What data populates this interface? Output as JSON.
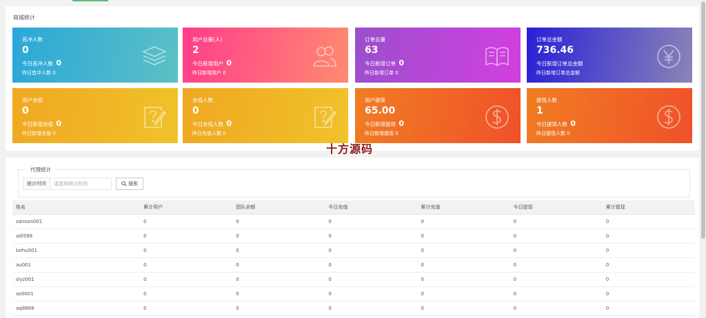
{
  "stats_panel": {
    "title": "商城统计",
    "cards": [
      {
        "title": "首冲人数",
        "value": "0",
        "line1_label": "今日首冲人数",
        "line1_value": "0",
        "line2": "昨日首冲人数 0",
        "icon": "layers-icon",
        "gradient": [
          "#2aa7d9",
          "#5cc0c5"
        ]
      },
      {
        "title": "用户总量(人)",
        "value": "2",
        "line1_label": "今日新增用户",
        "line1_value": "0",
        "line2": "昨日新增用户 0",
        "icon": "users-icon",
        "gradient": [
          "#ff3d8b",
          "#ff8a70"
        ]
      },
      {
        "title": "订单总量",
        "value": "63",
        "line1_label": "今日新增订单",
        "line1_value": "0",
        "line2": "昨日新增订单 0",
        "icon": "book-icon",
        "gradient": [
          "#9b4fcc",
          "#d23fe0"
        ]
      },
      {
        "title": "订单总金额",
        "value": "736.46",
        "line1_label": "今日新增订单总金额",
        "line1_value": "",
        "line2": "昨日新增订单总金额",
        "icon": "yen-icon",
        "gradient": [
          "#2a1fd6",
          "#8a85b8"
        ]
      },
      {
        "title": "用户充值",
        "value": "0",
        "line1_label": "今日新增充值",
        "line1_value": "0",
        "line2": "昨日新增充值 0",
        "icon": "edit-question-icon",
        "gradient": [
          "#f0a822",
          "#f0c22a"
        ]
      },
      {
        "title": "充值人数",
        "value": "0",
        "line1_label": "今日充值人数",
        "line1_value": "0",
        "line2": "昨日充值人数 0",
        "icon": "edit-question-icon",
        "gradient": [
          "#f0a822",
          "#f0c22a"
        ]
      },
      {
        "title": "用户提现",
        "value": "65.00",
        "line1_label": "今日新增提现",
        "line1_value": "0",
        "line2": "昨日新增提现 0",
        "icon": "dollar-icon",
        "gradient": [
          "#f07d22",
          "#f0512a"
        ]
      },
      {
        "title": "提现人数",
        "value": "1",
        "line1_label": "今日提现人数",
        "line1_value": "0",
        "line2": "昨日提现人数 0",
        "icon": "dollar-icon",
        "gradient": [
          "#f07d22",
          "#f0512a"
        ]
      }
    ]
  },
  "watermark": "十方源码",
  "agent_panel": {
    "legend": "代理统计",
    "filter_label": "统计时间",
    "filter_placeholder": "请选择统计时间",
    "search_button": "搜索",
    "columns": [
      "姓名",
      "累计用户",
      "团队余额",
      "今日充值",
      "累计充值",
      "今日提现",
      "累计提现"
    ],
    "rows": [
      [
        "sansan001",
        "0",
        "0",
        "0",
        "0",
        "0",
        "0"
      ],
      [
        "adi588",
        "0",
        "0",
        "0",
        "0",
        "0",
        "0"
      ],
      [
        "bohu001",
        "0",
        "0",
        "0",
        "0",
        "0",
        "0"
      ],
      [
        "au001",
        "0",
        "0",
        "0",
        "0",
        "0",
        "0"
      ],
      [
        "slyz001",
        "0",
        "0",
        "0",
        "0",
        "0",
        "0"
      ],
      [
        "az0001",
        "0",
        "0",
        "0",
        "0",
        "0",
        "0"
      ],
      [
        "aq8888",
        "0",
        "0",
        "0",
        "0",
        "0",
        "0"
      ]
    ]
  }
}
